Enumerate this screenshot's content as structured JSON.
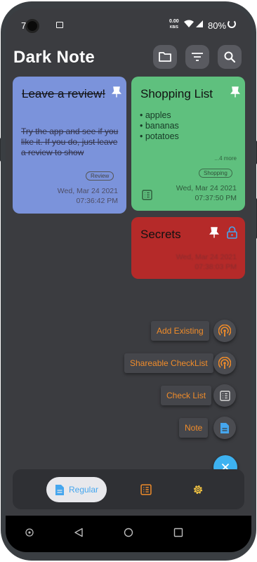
{
  "status_bar": {
    "time": "7 03",
    "net_speed_top": "0.00",
    "net_speed_unit": "KB/S",
    "battery": "80%"
  },
  "app": {
    "title": "Dark Note",
    "header_buttons": [
      "folder-icon",
      "filter-icon",
      "search-icon"
    ]
  },
  "notes": [
    {
      "title": "Leave a review!",
      "body": "Try the app and see if you like it. If you do, just leave a review to show",
      "tag": "Review",
      "date": "Wed, Mar 24 2021",
      "time": "07:36:42 PM",
      "color": "#7b93db",
      "pinned": true,
      "struck": true
    },
    {
      "title": "Shopping List",
      "items": [
        "• apples",
        "• bananas",
        "• potatoes"
      ],
      "more": "...4 more",
      "tag": "Shopping",
      "date": "Wed, Mar 24 2021",
      "time": "07:37:50 PM",
      "color": "#5fc07e",
      "pinned": true
    },
    {
      "title": "Secrets",
      "date": "Wed, Mar 24 2021",
      "time": "07:38:03 PM",
      "color": "#b52a29",
      "pinned": true,
      "locked": true
    }
  ],
  "fab_menu": [
    {
      "label": "Add Existing",
      "icon": "podcast-icon",
      "color": "#f08c2a"
    },
    {
      "label": "Shareable CheckList",
      "icon": "podcast-icon",
      "color": "#f08c2a"
    },
    {
      "label": "Check List",
      "icon": "list-icon",
      "color": "#d9d9d9"
    },
    {
      "label": "Note",
      "icon": "note-icon",
      "color": "#45a6ee"
    }
  ],
  "fab_main_icon": "close-icon",
  "bottom_nav": {
    "active_label": "Regular",
    "items": [
      "note-icon",
      "list-icon",
      "gear-icon"
    ]
  },
  "colors": {
    "background": "#3b3c40",
    "accent_orange": "#f08c2a",
    "accent_blue": "#3db2f1"
  }
}
